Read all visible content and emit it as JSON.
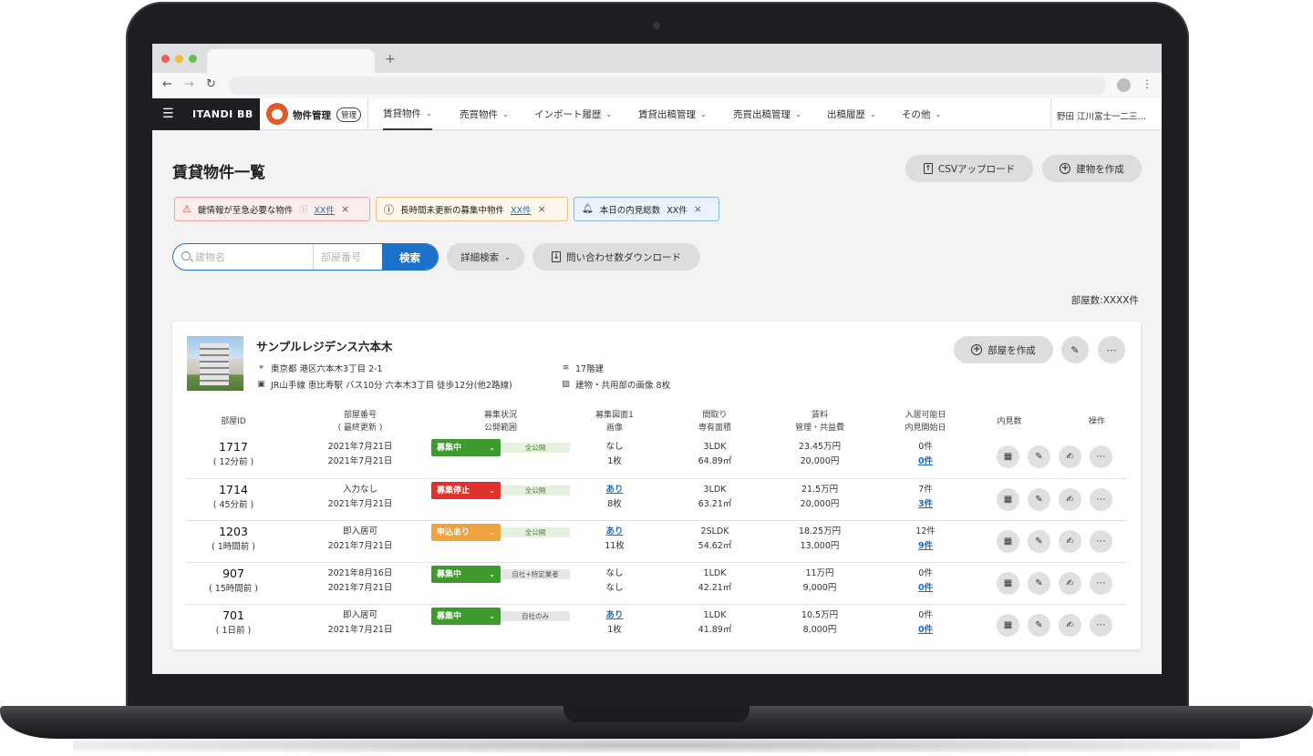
{
  "colors": {
    "accent": "#1a72c9",
    "status_green": "#3e9a2c",
    "status_red": "#e0322d",
    "status_orange": "#eea33e",
    "brand_dark": "#1e1f24"
  },
  "browser": {
    "new_tab": "+"
  },
  "app": {
    "brand": "ITANDI BB",
    "product": "物件管理",
    "product_badge": "管理",
    "menu": [
      "賃貸物件",
      "売買物件",
      "インポート履歴",
      "賃貸出稿管理",
      "売買出稿管理",
      "出稿履歴",
      "その他"
    ],
    "user": "野田 江川富士一二三…"
  },
  "page": {
    "title": "賃貸物件一覧",
    "csv_upload": "CSVアップロード",
    "create_building": "建物を作成"
  },
  "alerts": [
    {
      "text": "鍵情報が至急必要な物件",
      "count": "XX件",
      "icon": "warning-icon"
    },
    {
      "text": "長時間未更新の募集中物件",
      "count": "XX件",
      "icon": "clock-alert-icon"
    },
    {
      "text": "本日の内見総数",
      "count": "XX件",
      "icon": "bell-icon"
    }
  ],
  "search": {
    "building_placeholder": "建物名",
    "room_placeholder": "部屋番号",
    "submit": "検索",
    "advanced": "詳細検索",
    "download": "問い合わせ数ダウンロード"
  },
  "room_count": "部屋数:XXXX件",
  "property": {
    "name": "サンプルレジデンス六本木",
    "address": "東京都 港区六本木3丁目 2-1",
    "access": "JR山手線 恵比寿駅 バス10分 六本木3丁目 徒歩12分(他2路線)",
    "floors": "17階建",
    "images": "建物・共用部の画像 8枚",
    "create_room": "部屋を作成"
  },
  "table": {
    "headers": [
      [
        "部屋ID"
      ],
      [
        "部屋番号",
        "( 最終更新 )"
      ],
      [
        "募集状況",
        "公開範囲"
      ],
      [
        "募集図面1",
        "画像"
      ],
      [
        "間取り",
        "専有面積"
      ],
      [
        "賃料",
        "管理・共益費"
      ],
      [
        "入居可能日",
        "内見開始日"
      ],
      [
        "内見数"
      ],
      [
        "操作"
      ]
    ],
    "rows": [
      {
        "id": "1717",
        "ago": "( 12分前 )",
        "room1": "2021年7月21日",
        "room2": "2021年7月21日",
        "status": "募集中",
        "status_color": "#3e9a2c",
        "scope": "全公開",
        "scope_green": true,
        "plan": "なし",
        "plan_link": false,
        "images": "1枚",
        "layout": "3LDK",
        "area": "64.89㎡",
        "rent": "23.45万円",
        "fee": "20,000円",
        "move_in": "0件",
        "viewings": "0件"
      },
      {
        "id": "1714",
        "ago": "( 45分前 )",
        "room1": "入力なし",
        "room2": "2021年7月21日",
        "status": "募集停止",
        "status_color": "#e0322d",
        "scope": "全公開",
        "scope_green": true,
        "plan": "あり",
        "plan_link": true,
        "images": "8枚",
        "layout": "3LDK",
        "area": "63.21㎡",
        "rent": "21.5万円",
        "fee": "20,000円",
        "move_in": "7件",
        "viewings": "3件"
      },
      {
        "id": "1203",
        "ago": "( 1時間前 )",
        "room1": "即入居可",
        "room2": "2021年7月21日",
        "status": "申込あり",
        "status_color": "#eea33e",
        "scope": "全公開",
        "scope_green": true,
        "plan": "あり",
        "plan_link": true,
        "images": "11枚",
        "layout": "2SLDK",
        "area": "54.62㎡",
        "rent": "18.25万円",
        "fee": "13,000円",
        "move_in": "12件",
        "viewings": "9件"
      },
      {
        "id": "907",
        "ago": "( 15時間前 )",
        "room1": "2021年8月16日",
        "room2": "2021年7月21日",
        "status": "募集中",
        "status_color": "#3e9a2c",
        "scope": "自社+特定業者",
        "scope_green": false,
        "plan": "なし",
        "plan_link": false,
        "images": "なし",
        "layout": "1LDK",
        "area": "42.21㎡",
        "rent": "11万円",
        "fee": "9,000円",
        "move_in": "0件",
        "viewings": "0件"
      },
      {
        "id": "701",
        "ago": "( 1日前 )",
        "room1": "即入居可",
        "room2": "2021年7月21日",
        "status": "募集中",
        "status_color": "#3e9a2c",
        "scope": "自社のみ",
        "scope_green": false,
        "plan": "あり",
        "plan_link": true,
        "images": "1枚",
        "layout": "1LDK",
        "area": "41.89㎡",
        "rent": "10.5万円",
        "fee": "8,000円",
        "move_in": "0件",
        "viewings": "0件"
      }
    ]
  }
}
